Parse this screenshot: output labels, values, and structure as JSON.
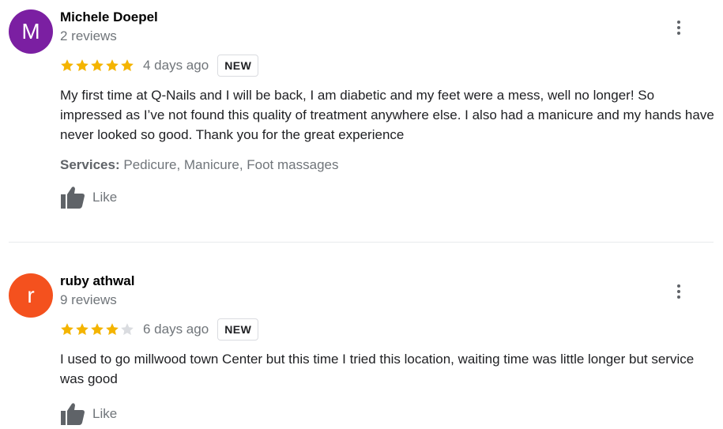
{
  "colors": {
    "star_filled": "#f4b400",
    "star_empty": "#dadce0",
    "meta_gray": "#70757a"
  },
  "reviews": [
    {
      "avatar_initial": "M",
      "avatar_color": "#7b1fa2",
      "name": "Michele Doepel",
      "review_count": "2 reviews",
      "rating": 5,
      "rating_max": 5,
      "date": "4 days ago",
      "badge": "NEW",
      "text": "My first time at Q-Nails and I will be back, I am diabetic and my feet were a mess, well no longer! So impressed as I’ve not found this quality of treatment anywhere else. I also had a manicure and my hands have never looked so good. Thank you for the great experience",
      "services_label": "Services:",
      "services_value": "Pedicure, Manicure, Foot massages",
      "like_label": "Like",
      "menu_icon": "more-vert-icon",
      "like_icon": "thumbs-up-icon"
    },
    {
      "avatar_initial": "r",
      "avatar_color": "#f4511e",
      "name": "ruby athwal",
      "review_count": "9 reviews",
      "rating": 4,
      "rating_max": 5,
      "date": "6 days ago",
      "badge": "NEW",
      "text": "I used to go millwood town Center but this time I tried this location, waiting time was little longer but service was good",
      "like_label": "Like",
      "menu_icon": "more-vert-icon",
      "like_icon": "thumbs-up-icon"
    }
  ]
}
